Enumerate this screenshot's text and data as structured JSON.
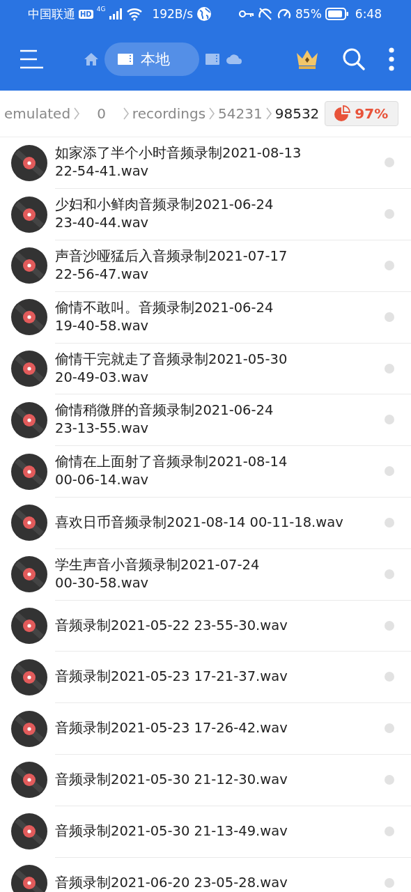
{
  "status_bar": {
    "carrier": "中国联通",
    "hd": "HD",
    "network": "4G",
    "speed": "192B/s",
    "battery": "85%",
    "time": "6:48"
  },
  "toolbar": {
    "locations": [
      {
        "kind": "home",
        "selected": false
      },
      {
        "kind": "local",
        "label": "本地",
        "selected": true
      },
      {
        "kind": "sdcard",
        "selected": false
      },
      {
        "kind": "cloud",
        "selected": false
      }
    ]
  },
  "breadcrumb": {
    "segments": [
      {
        "label": "emulated",
        "current": false
      },
      {
        "label": "0",
        "current": false
      },
      {
        "label": "recordings",
        "current": false
      },
      {
        "label": "54231",
        "current": false
      },
      {
        "label": "98532",
        "current": true
      }
    ],
    "storage": "97%"
  },
  "files": [
    {
      "name": "如家添了半个小时音频录制2021-08-13\n22-54-41.wav",
      "checked": false
    },
    {
      "name": "少妇和小鲜肉音频录制2021-06-24\n23-40-44.wav",
      "checked": false
    },
    {
      "name": "声音沙哑猛后入音频录制2021-07-17\n22-56-47.wav",
      "checked": false
    },
    {
      "name": "偷情不敢叫。音频录制2021-06-24\n19-40-58.wav",
      "checked": false
    },
    {
      "name": "偷情干完就走了音频录制2021-05-30\n20-49-03.wav",
      "checked": false
    },
    {
      "name": "偷情稍微胖的音频录制2021-06-24\n23-13-55.wav",
      "checked": false
    },
    {
      "name": "偷情在上面射了音频录制2021-08-14\n00-06-14.wav",
      "checked": false
    },
    {
      "name": "喜欢日币音频录制2021-08-14 00-11-18.wav",
      "checked": false
    },
    {
      "name": "学生声音小音频录制2021-07-24\n00-30-58.wav",
      "checked": false
    },
    {
      "name": "音频录制2021-05-22 23-55-30.wav",
      "checked": false
    },
    {
      "name": "音频录制2021-05-23 17-21-37.wav",
      "checked": false
    },
    {
      "name": "音频录制2021-05-23 17-26-42.wav",
      "checked": false
    },
    {
      "name": "音频录制2021-05-30 21-12-30.wav",
      "checked": false
    },
    {
      "name": "音频录制2021-05-30 21-13-49.wav",
      "checked": false
    },
    {
      "name": "音频录制2021-06-20 23-05-28.wav",
      "checked": false
    }
  ]
}
